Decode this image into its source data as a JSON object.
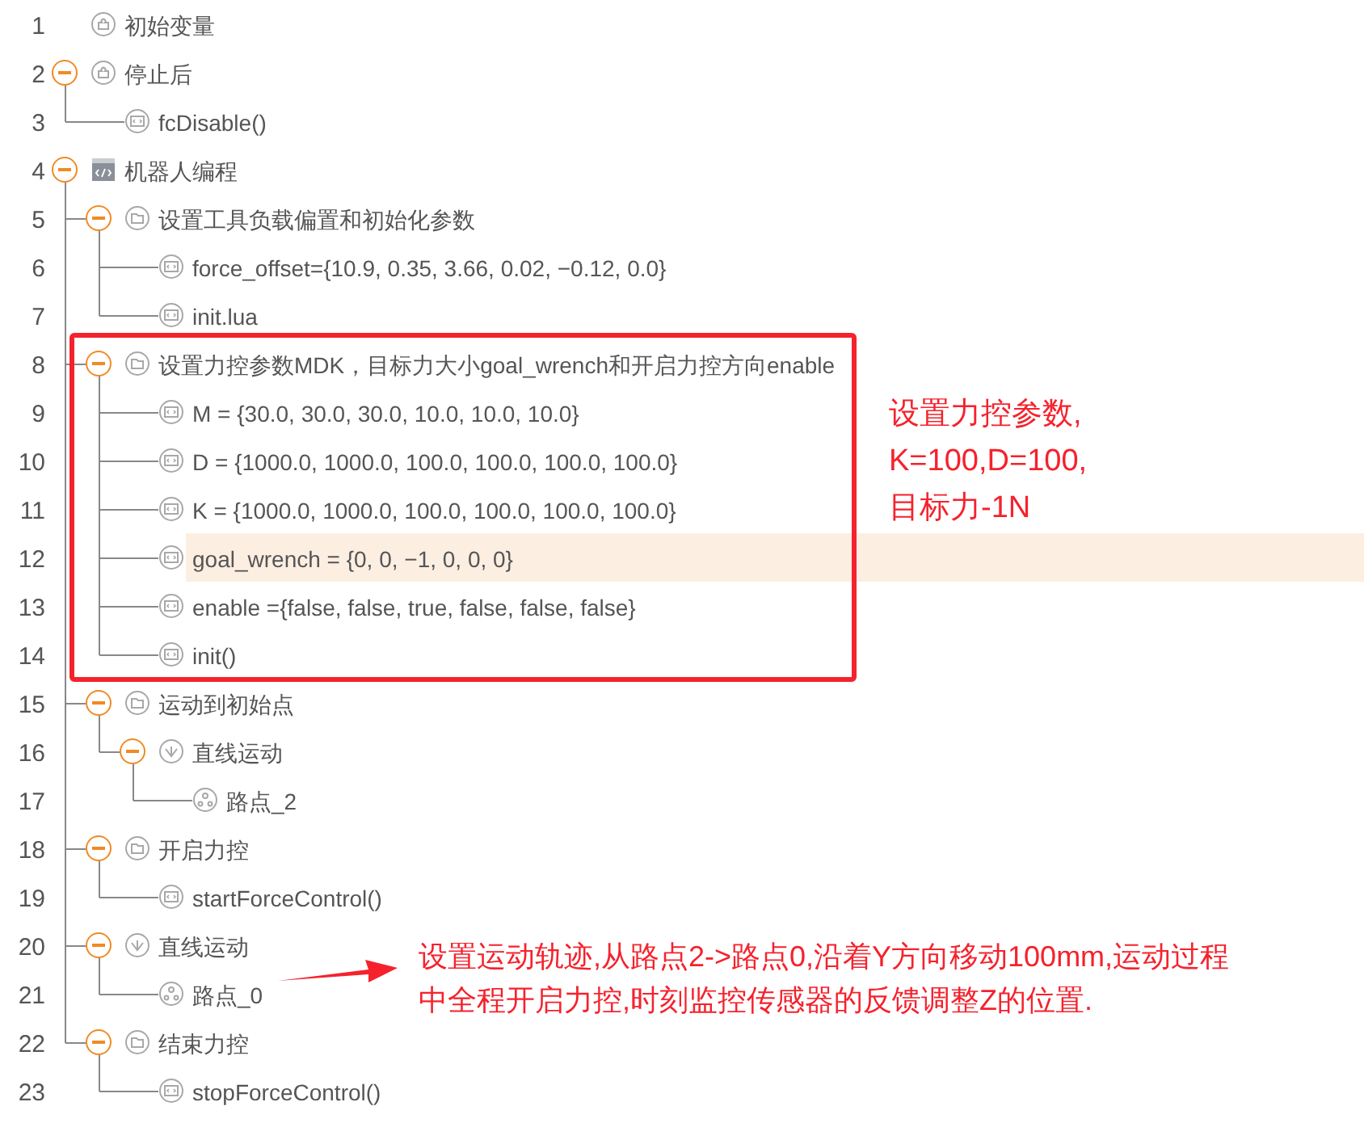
{
  "tree": [
    {
      "line": "1",
      "label": "初始变量",
      "kind": "variable",
      "selected": false
    },
    {
      "line": "2",
      "label": "停止后",
      "kind": "variable",
      "expanded": true,
      "selected": false,
      "children": [
        {
          "line": "3",
          "label": "fcDisable()",
          "kind": "code",
          "selected": false
        }
      ]
    },
    {
      "line": "4",
      "label": "机器人编程",
      "kind": "program",
      "expanded": true,
      "selected": false,
      "children": [
        {
          "line": "5",
          "label": "设置工具负载偏置和初始化参数",
          "kind": "folder",
          "expanded": true,
          "selected": false,
          "children": [
            {
              "line": "6",
              "label": "force_offset={10.9, 0.35, 3.66, 0.02, −0.12, 0.0}",
              "kind": "code",
              "selected": false
            },
            {
              "line": "7",
              "label": "init.lua",
              "kind": "code",
              "selected": false
            }
          ]
        },
        {
          "line": "8",
          "label": "设置力控参数MDK，目标力大小goal_wrench和开启力控方向enable",
          "kind": "folder",
          "expanded": true,
          "selected": false,
          "children": [
            {
              "line": "9",
              "label": "M = {30.0, 30.0, 30.0, 10.0, 10.0, 10.0}",
              "kind": "code",
              "selected": false
            },
            {
              "line": "10",
              "label": "D = {1000.0, 1000.0, 100.0, 100.0, 100.0, 100.0}",
              "kind": "code",
              "selected": false
            },
            {
              "line": "11",
              "label": "K = {1000.0, 1000.0, 100.0, 100.0, 100.0, 100.0}",
              "kind": "code",
              "selected": false
            },
            {
              "line": "12",
              "label": "goal_wrench = {0, 0, −1, 0, 0, 0}",
              "kind": "code",
              "selected": true
            },
            {
              "line": "13",
              "label": "enable ={false, false, true, false, false, false}",
              "kind": "code",
              "selected": false
            },
            {
              "line": "14",
              "label": "init()",
              "kind": "code",
              "selected": false
            }
          ]
        },
        {
          "line": "15",
          "label": "运动到初始点",
          "kind": "folder",
          "expanded": true,
          "selected": false,
          "children": [
            {
              "line": "16",
              "label": "直线运动",
              "kind": "motion",
              "expanded": true,
              "selected": false,
              "children": [
                {
                  "line": "17",
                  "label": "路点_2",
                  "kind": "waypoint",
                  "selected": false
                }
              ]
            }
          ]
        },
        {
          "line": "18",
          "label": "开启力控",
          "kind": "folder",
          "expanded": true,
          "selected": false,
          "children": [
            {
              "line": "19",
              "label": "startForceControl()",
              "kind": "code",
              "selected": false
            }
          ]
        },
        {
          "line": "20",
          "label": "直线运动",
          "kind": "motion",
          "expanded": true,
          "selected": false,
          "children": [
            {
              "line": "21",
              "label": "路点_0",
              "kind": "waypoint",
              "selected": false
            }
          ]
        },
        {
          "line": "22",
          "label": "结束力控",
          "kind": "folder",
          "expanded": true,
          "selected": false,
          "children": [
            {
              "line": "23",
              "label": "stopForceControl()",
              "kind": "code",
              "selected": false
            }
          ]
        }
      ]
    }
  ],
  "annotations": [
    {
      "kind": "box_note",
      "lines": [
        "设置力控参数,",
        "K=100,D=100,",
        "目标力-1N"
      ]
    },
    {
      "kind": "arrow_note",
      "lines": [
        "设置运动轨迹,从路点2->路点0,沿着Y方向移动100mm,运动过程",
        "中全程开启力控,时刻监控传感器的反馈调整Z的位置."
      ]
    }
  ]
}
